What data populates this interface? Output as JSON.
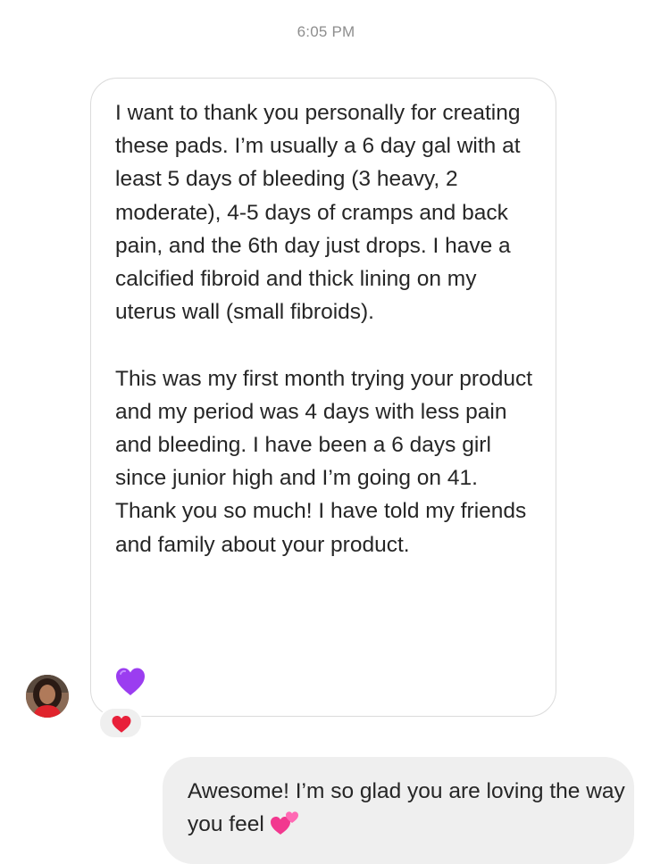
{
  "timestamp": "6:05 PM",
  "incoming_message": {
    "text": "I want to thank you personally for creating these pads.  I’m usually a 6 day gal with at least 5 days of bleeding (3 heavy, 2 moderate), 4-5 days of cramps and back pain, and the 6th day just drops. I have a calcified fibroid and thick lining on my uterus wall (small fibroids).\n\nThis was my first month trying your product and my period was 4 days with less pain and bleeding. I have been a 6 days girl since junior high and I’m going on 41.  Thank you so much!  I have told my friends and family about your product.",
    "emoji": "purple-heart-icon",
    "reaction": "red-heart-icon"
  },
  "outgoing_message": {
    "text": "Awesome! I’m so glad you are loving the way you feel",
    "emoji": "two-hearts-icon"
  },
  "colors": {
    "bubble_border": "#dbdbdb",
    "outgoing_bg": "#efefef",
    "timestamp": "#8e8e8e",
    "purple_heart": "#9b3df0",
    "red_heart": "#e8203a",
    "pink_hearts": "#f2388f"
  }
}
